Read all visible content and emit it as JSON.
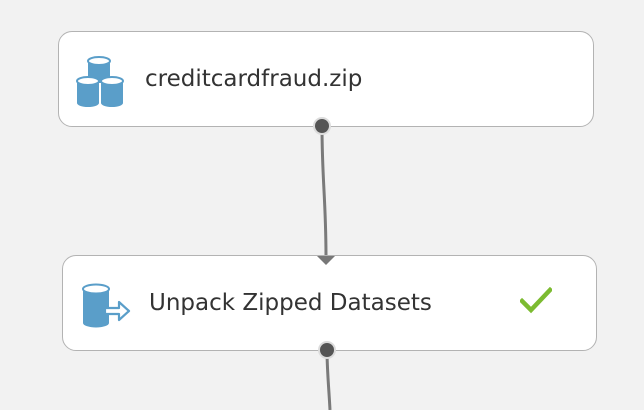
{
  "modules": [
    {
      "label": "creditcardfraud.zip",
      "icon": "dataset-stack-icon",
      "status": ""
    },
    {
      "label": "Unpack Zipped Datasets",
      "icon": "unpack-dataset-icon",
      "status": "completed-check-icon"
    }
  ],
  "colors": {
    "canvas": "#f2f2f2",
    "module_border": "#b3b3b3",
    "icon_blue": "#5a9ec9",
    "check_green": "#7cbb31",
    "wire": "#7a7a7a"
  }
}
